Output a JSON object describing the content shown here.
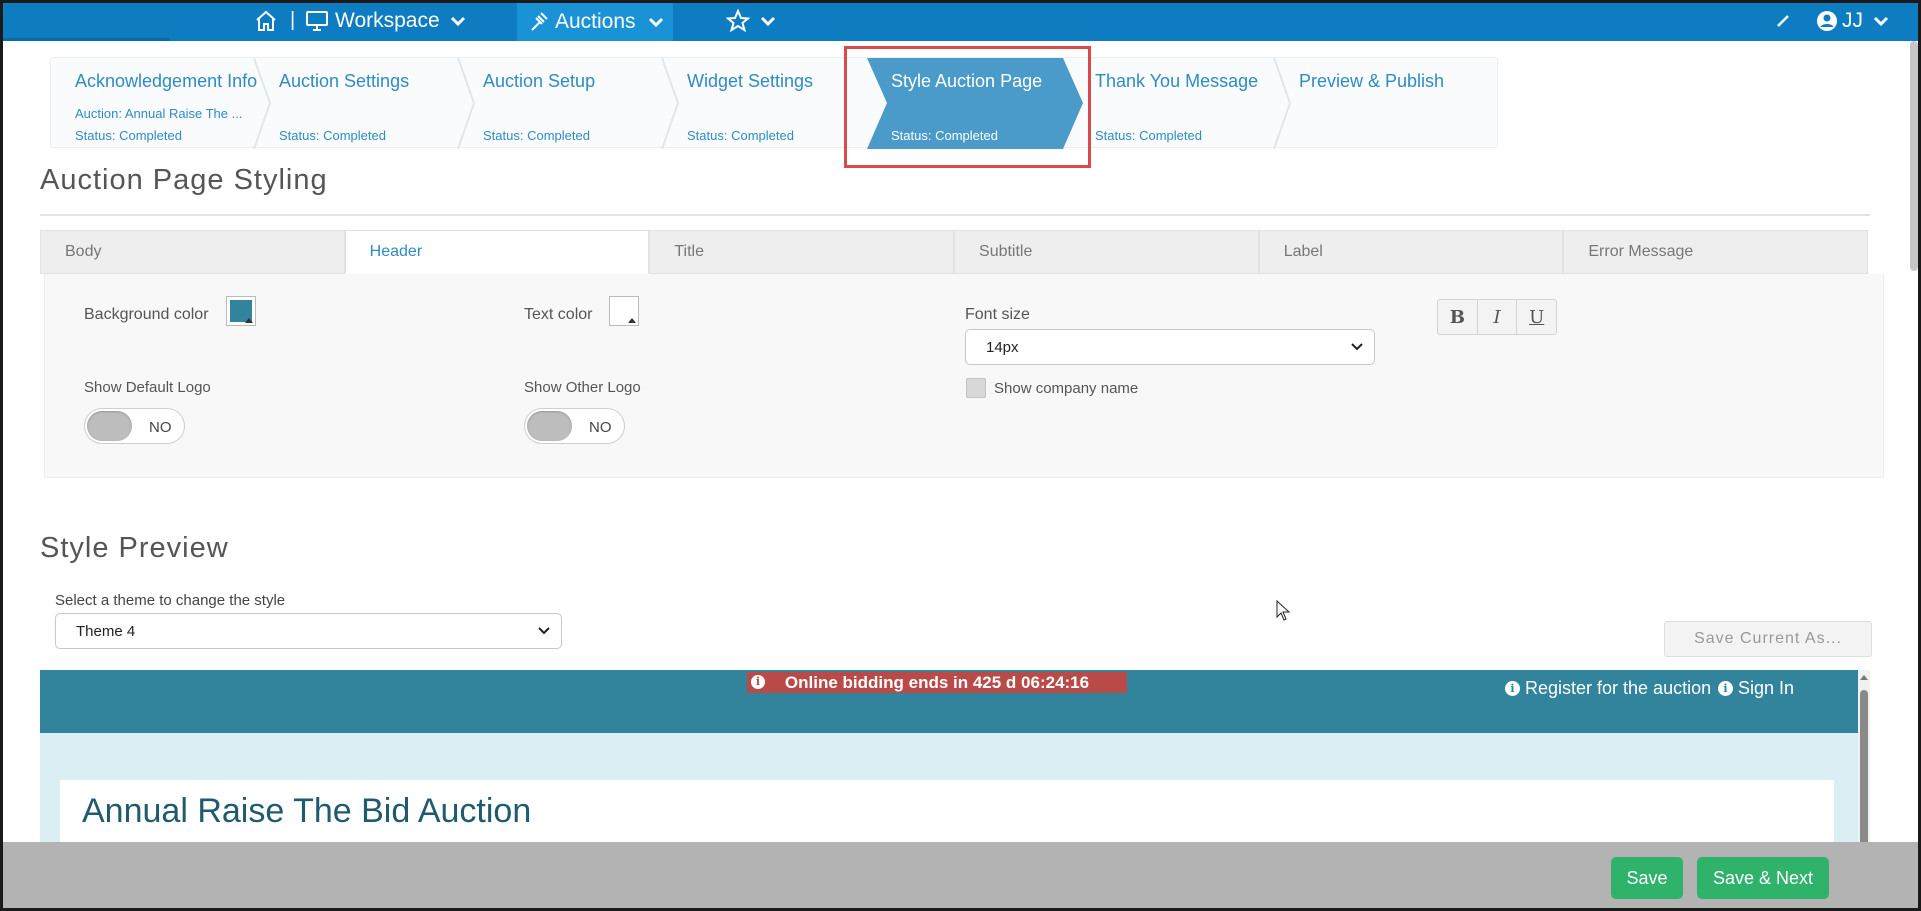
{
  "topnav": {
    "workspace_label": "Workspace",
    "auctions_label": "Auctions",
    "user_initials": "JJ",
    "separator": "|"
  },
  "steps": [
    {
      "title": "Acknowledgement Info",
      "subtitle": "Auction: Annual Raise The ...",
      "status": "Status: Completed"
    },
    {
      "title": "Auction Settings",
      "subtitle": "",
      "status": "Status: Completed"
    },
    {
      "title": "Auction Setup",
      "subtitle": "",
      "status": "Status: Completed"
    },
    {
      "title": "Widget Settings",
      "subtitle": "",
      "status": "Status: Completed"
    },
    {
      "title": "Style Auction Page",
      "subtitle": "",
      "status": "Status: Completed",
      "active": true
    },
    {
      "title": "Thank You Message",
      "subtitle": "",
      "status": "Status: Completed"
    },
    {
      "title": "Preview & Publish",
      "subtitle": "",
      "status": ""
    }
  ],
  "styling": {
    "title": "Auction Page Styling",
    "tabs": [
      "Body",
      "Header",
      "Title",
      "Subtitle",
      "Label",
      "Error Message"
    ],
    "active_tab": "Header",
    "background_color_label": "Background color",
    "background_color": "#31849b",
    "text_color_label": "Text color",
    "text_color": "#ffffff",
    "font_size_label": "Font size",
    "font_size_value": "14px",
    "format_buttons": [
      "B",
      "I",
      "U"
    ],
    "show_default_logo_label": "Show Default Logo",
    "show_default_logo_value": "NO",
    "show_other_logo_label": "Show Other Logo",
    "show_other_logo_value": "NO",
    "show_company_name_label": "Show company name"
  },
  "preview": {
    "title": "Style Preview",
    "theme_label": "Select a theme to change the style",
    "theme_value": "Theme 4",
    "save_as_label": "Save Current As...",
    "alert_text": "Online bidding ends in 425 d 06:24:16",
    "register_link": "Register for the auction",
    "sign_in_link": "Sign In",
    "auction_title": "Annual Raise The Bid Auction"
  },
  "footer": {
    "save_label": "Save",
    "save_next_label": "Save & Next"
  },
  "colors": {
    "nav_blue": "#0d7cc0",
    "step_active": "#4a9bc9",
    "accent_green": "#2fb36a",
    "preview_header": "#31849b"
  }
}
